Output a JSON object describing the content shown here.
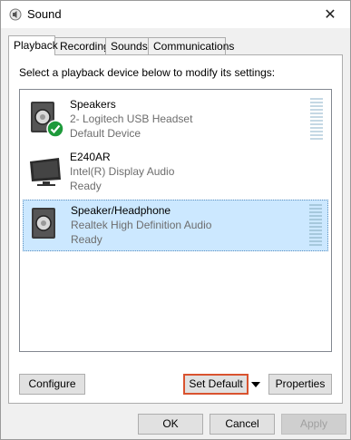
{
  "window": {
    "title": "Sound",
    "close_glyph": "✕"
  },
  "tabs": [
    {
      "label": "Playback",
      "active": true
    },
    {
      "label": "Recording",
      "active": false
    },
    {
      "label": "Sounds",
      "active": false
    },
    {
      "label": "Communications",
      "active": false
    }
  ],
  "instruction": "Select a playback device below to modify its settings:",
  "devices": [
    {
      "name": "Speakers",
      "description": "2- Logitech USB Headset",
      "status": "Default Device",
      "icon": "speaker-icon",
      "default_badge": true,
      "selected": false
    },
    {
      "name": "E240AR",
      "description": "Intel(R) Display Audio",
      "status": "Ready",
      "icon": "monitor-icon",
      "default_badge": false,
      "selected": false
    },
    {
      "name": "Speaker/Headphone",
      "description": "Realtek High Definition Audio",
      "status": "Ready",
      "icon": "speaker-icon",
      "default_badge": false,
      "selected": true
    }
  ],
  "buttons": {
    "configure": "Configure",
    "set_default": "Set Default",
    "properties": "Properties",
    "ok": "OK",
    "cancel": "Cancel",
    "apply": "Apply"
  },
  "colors": {
    "selection": "#cce8ff",
    "focus_border": "#d9532f",
    "check_green": "#1e9a3b"
  }
}
